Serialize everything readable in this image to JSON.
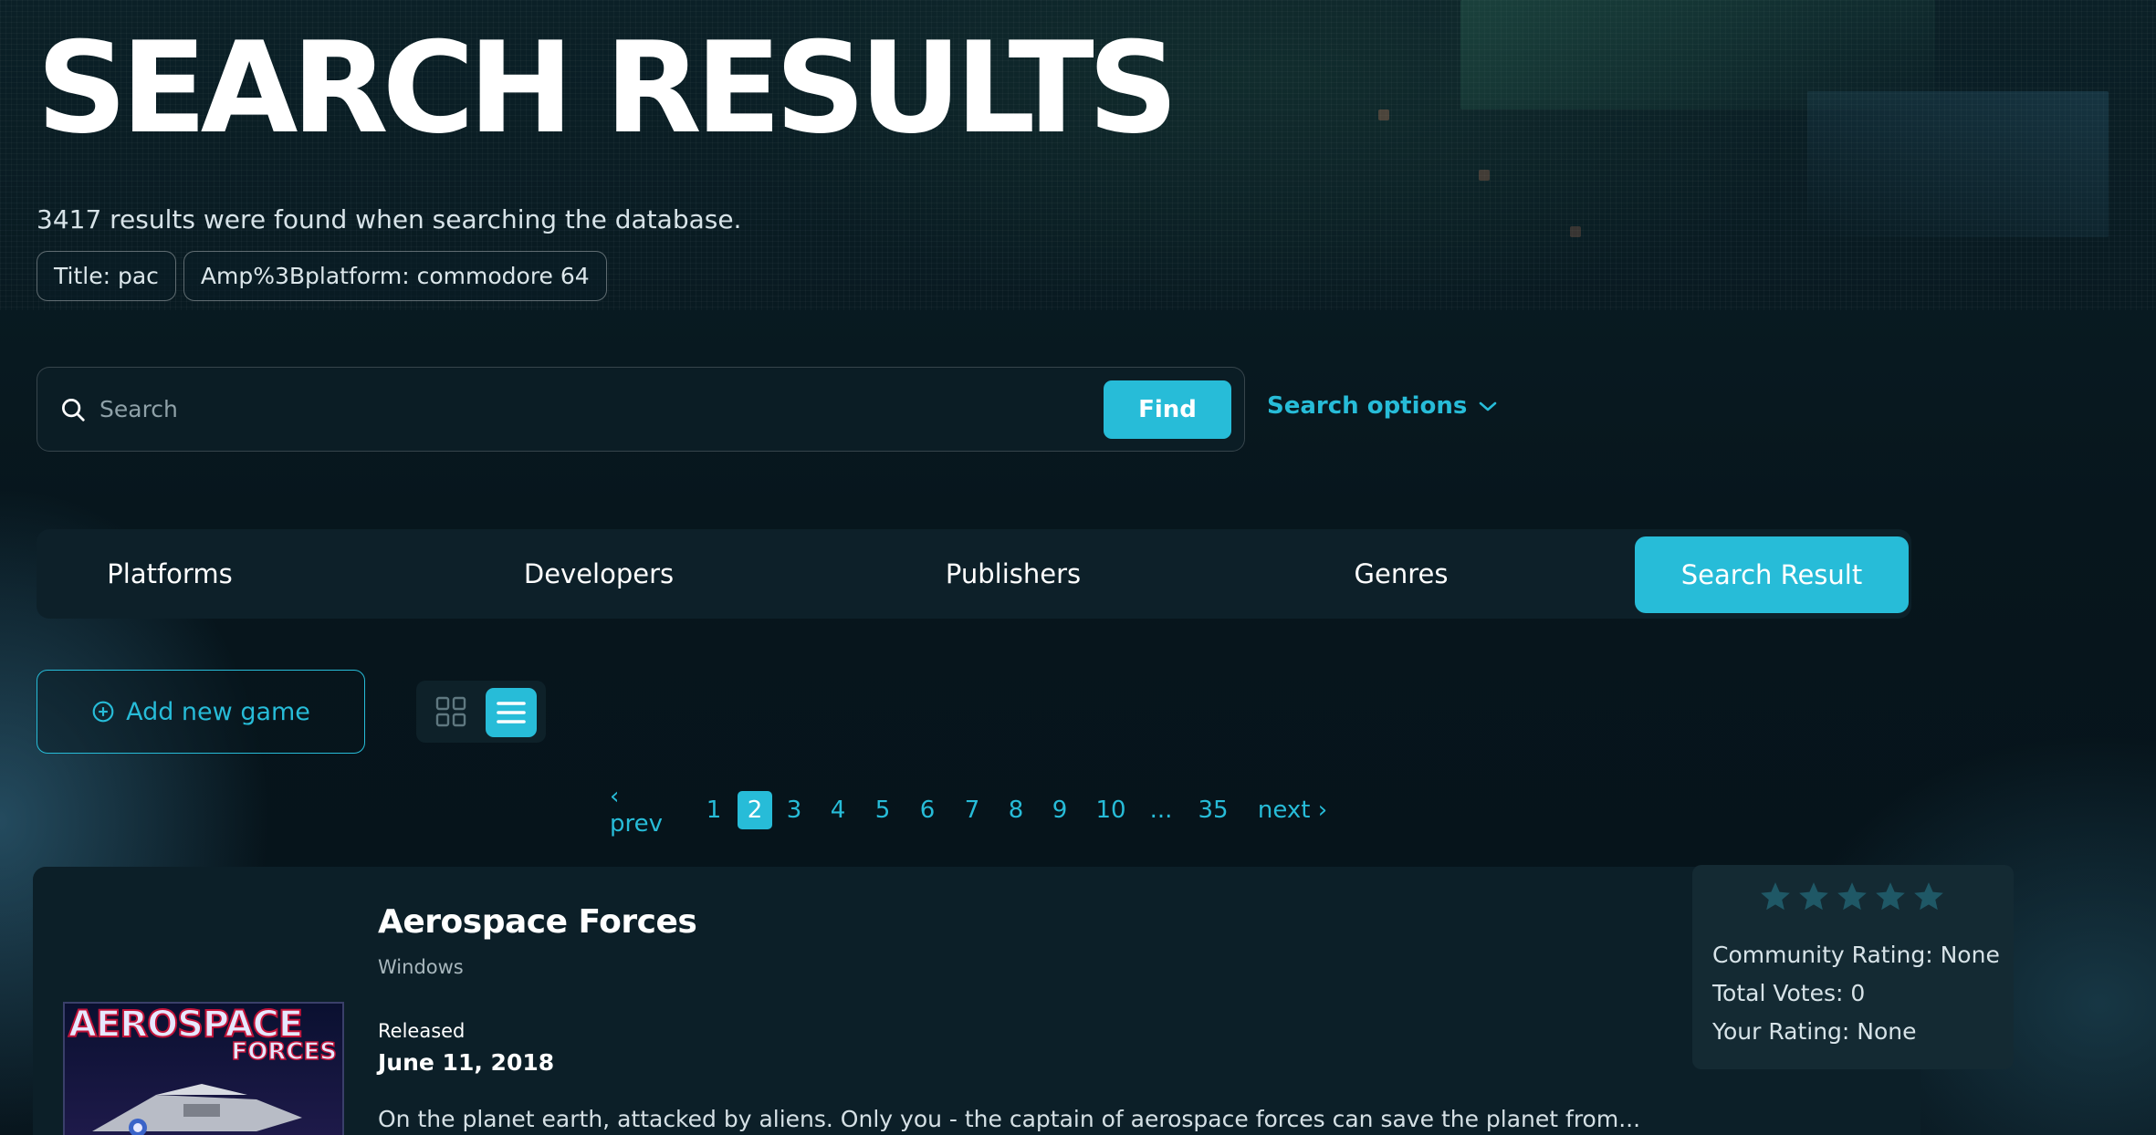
{
  "page": {
    "title": "SEARCH RESULTS",
    "result_count_text": "3417 results were found when searching the database."
  },
  "filters": [
    {
      "label": "Title: pac"
    },
    {
      "label": "Amp%3Bplatform: commodore 64"
    }
  ],
  "search": {
    "placeholder": "Search",
    "value": "",
    "find_label": "Find",
    "options_label": "Search options"
  },
  "tabs": [
    {
      "label": "Platforms",
      "active": false
    },
    {
      "label": "Developers",
      "active": false
    },
    {
      "label": "Publishers",
      "active": false
    },
    {
      "label": "Genres",
      "active": false
    },
    {
      "label": "Search Result",
      "active": true
    }
  ],
  "toolbar": {
    "add_game_label": "Add new game",
    "view_mode": "list"
  },
  "pagination": {
    "prev_label": "‹ prev",
    "pages": [
      "1",
      "2",
      "3",
      "4",
      "5",
      "6",
      "7",
      "8",
      "9",
      "10",
      "...",
      "35"
    ],
    "current": "2",
    "next_label": "next ›"
  },
  "results": [
    {
      "title": "Aerospace Forces",
      "platform": "Windows",
      "released_label": "Released",
      "released_date": "June 11, 2018",
      "description": "On the planet earth, attacked by aliens. Only you - the captain of aerospace forces can save the planet from...",
      "cover_text": "AEROSPACE",
      "cover_subtext": "FORCES",
      "rating": {
        "stars_filled": 0,
        "stars_total": 5,
        "community_rating": "Community Rating: None",
        "total_votes": "Total Votes: 0",
        "your_rating": "Your Rating: None"
      }
    }
  ],
  "colors": {
    "accent": "#27bcd8",
    "background": "#07171f",
    "panel": "#0c1f28",
    "star_empty": "#1f5866"
  }
}
